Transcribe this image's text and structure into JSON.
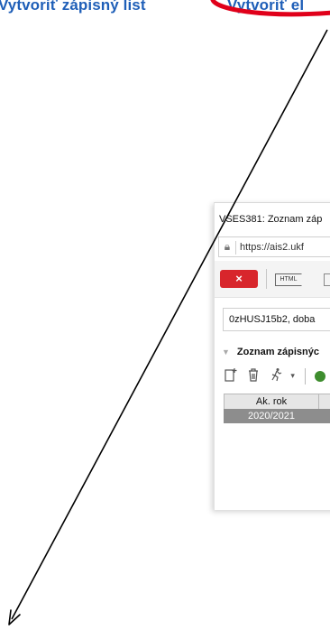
{
  "header": {
    "link_1": "Vytvoriť zápisný list",
    "link_2": "Vytvoriť el"
  },
  "window": {
    "title": "VSES381: Zoznam záp",
    "url": "https://ais2.ukf",
    "toolbar": {
      "close_label": "×",
      "html_label": "HTML"
    },
    "info_field": "0zHUSJ15b2, doba",
    "panel": {
      "title": "Zoznam zápisnýc"
    },
    "table": {
      "columns": [
        "Ak. rok"
      ],
      "rows": [
        [
          "2020/2021"
        ]
      ]
    }
  },
  "colors": {
    "header_link": "#1f5fb8",
    "close_button": "#d8262c",
    "annotation_red": "#e0001a",
    "selected_row": "#8d8d8d"
  },
  "icons": [
    "lock-icon",
    "add-icon",
    "delete-icon",
    "run-icon",
    "dropdown-icon",
    "green-status-icon",
    "panel-collapse-icon"
  ]
}
